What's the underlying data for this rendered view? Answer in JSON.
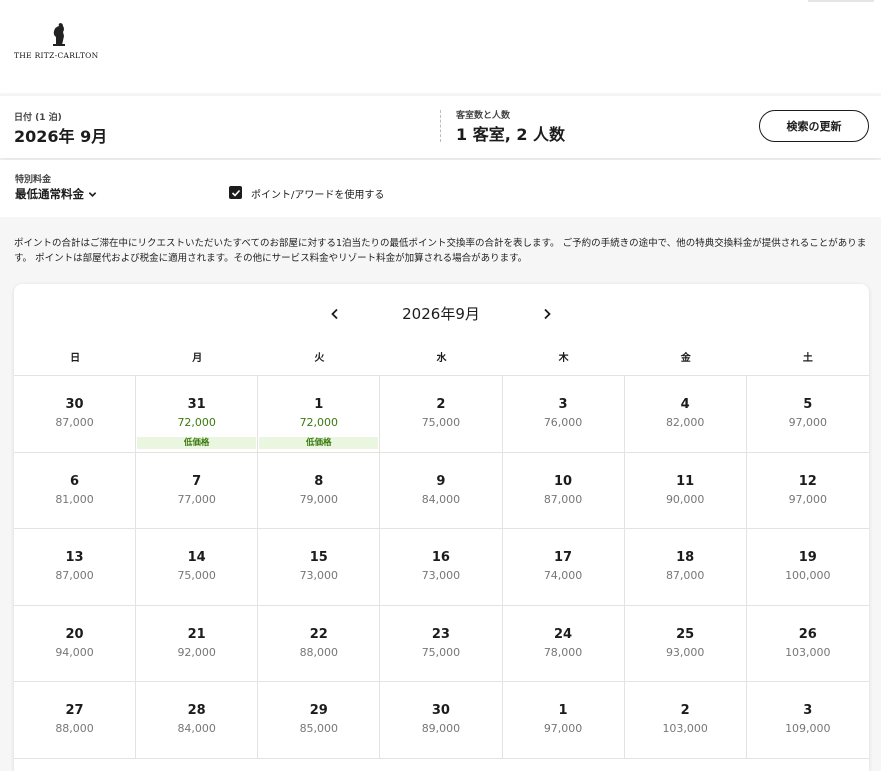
{
  "brand": {
    "name": "THE RITZ-CARLTON"
  },
  "search": {
    "date_label": "日付 (1 泊)",
    "date_value": "2026年 9月",
    "guests_label": "客室数と人数",
    "guests_value": "1 客室, 2 人数",
    "update_button": "検索の更新"
  },
  "filters": {
    "rate_label": "特別料金",
    "rate_value": "最低通常料金",
    "points_checkbox_label": "ポイント/アワードを使用する",
    "points_checked": true
  },
  "note": "ポイントの合計はご滞在中にリクエストいただいたすべてのお部屋に対する1泊当たりの最低ポイント交換率の合計を表します。 ご予約の手続きの途中で、他の特典交換料金が提供されることがあります。 ポイントは部屋代および税金に適用されます。その他にサービス料金やリゾート料金が加算される場合があります。",
  "calendar": {
    "month_title": "2026年9月",
    "weekdays": [
      "日",
      "月",
      "火",
      "水",
      "木",
      "金",
      "土"
    ],
    "low_badge_text": "低価格",
    "colors": {
      "low_price": "#3b7a10",
      "low_badge_bg": "#eaf6df",
      "regular_price": "#777777"
    },
    "weeks": [
      [
        {
          "day": "30",
          "points": "87,000"
        },
        {
          "day": "31",
          "points": "72,000",
          "low": true
        },
        {
          "day": "1",
          "points": "72,000",
          "low": true
        },
        {
          "day": "2",
          "points": "75,000"
        },
        {
          "day": "3",
          "points": "76,000"
        },
        {
          "day": "4",
          "points": "82,000"
        },
        {
          "day": "5",
          "points": "97,000"
        }
      ],
      [
        {
          "day": "6",
          "points": "81,000"
        },
        {
          "day": "7",
          "points": "77,000"
        },
        {
          "day": "8",
          "points": "79,000"
        },
        {
          "day": "9",
          "points": "84,000"
        },
        {
          "day": "10",
          "points": "87,000"
        },
        {
          "day": "11",
          "points": "90,000"
        },
        {
          "day": "12",
          "points": "97,000"
        }
      ],
      [
        {
          "day": "13",
          "points": "87,000"
        },
        {
          "day": "14",
          "points": "75,000"
        },
        {
          "day": "15",
          "points": "73,000"
        },
        {
          "day": "16",
          "points": "73,000"
        },
        {
          "day": "17",
          "points": "74,000"
        },
        {
          "day": "18",
          "points": "87,000"
        },
        {
          "day": "19",
          "points": "100,000"
        }
      ],
      [
        {
          "day": "20",
          "points": "94,000"
        },
        {
          "day": "21",
          "points": "92,000"
        },
        {
          "day": "22",
          "points": "88,000"
        },
        {
          "day": "23",
          "points": "75,000"
        },
        {
          "day": "24",
          "points": "78,000"
        },
        {
          "day": "25",
          "points": "93,000"
        },
        {
          "day": "26",
          "points": "103,000"
        }
      ],
      [
        {
          "day": "27",
          "points": "88,000"
        },
        {
          "day": "28",
          "points": "84,000"
        },
        {
          "day": "29",
          "points": "85,000"
        },
        {
          "day": "30",
          "points": "89,000"
        },
        {
          "day": "1",
          "points": "97,000"
        },
        {
          "day": "2",
          "points": "103,000"
        },
        {
          "day": "3",
          "points": "109,000"
        }
      ]
    ]
  }
}
